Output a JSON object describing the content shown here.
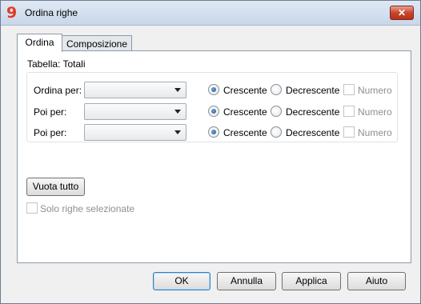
{
  "window": {
    "title": "Ordina righe",
    "app_icon": "9",
    "close_label": "✕"
  },
  "tabs": [
    {
      "label": "Ordina",
      "active": true
    },
    {
      "label": "Composizione",
      "active": false
    }
  ],
  "table_label": "Tabella: Totali",
  "sort_rows": [
    {
      "label": "Ordina per:",
      "value": "",
      "ascending": "Crescente",
      "descending": "Decrescente",
      "numeric": "Numero",
      "selected": "ascending"
    },
    {
      "label": "Poi per:",
      "value": "",
      "ascending": "Crescente",
      "descending": "Decrescente",
      "numeric": "Numero",
      "selected": "ascending"
    },
    {
      "label": "Poi per:",
      "value": "",
      "ascending": "Crescente",
      "descending": "Decrescente",
      "numeric": "Numero",
      "selected": "ascending"
    }
  ],
  "clear_all_label": "Vuota tutto",
  "only_selected_label": "Solo righe selezionate",
  "buttons": {
    "ok": "OK",
    "cancel": "Annulla",
    "apply": "Applica",
    "help": "Aiuto"
  },
  "colors": {
    "accent": "#3c7fb1",
    "close": "#c8452b",
    "app_icon": "#e03b24"
  }
}
